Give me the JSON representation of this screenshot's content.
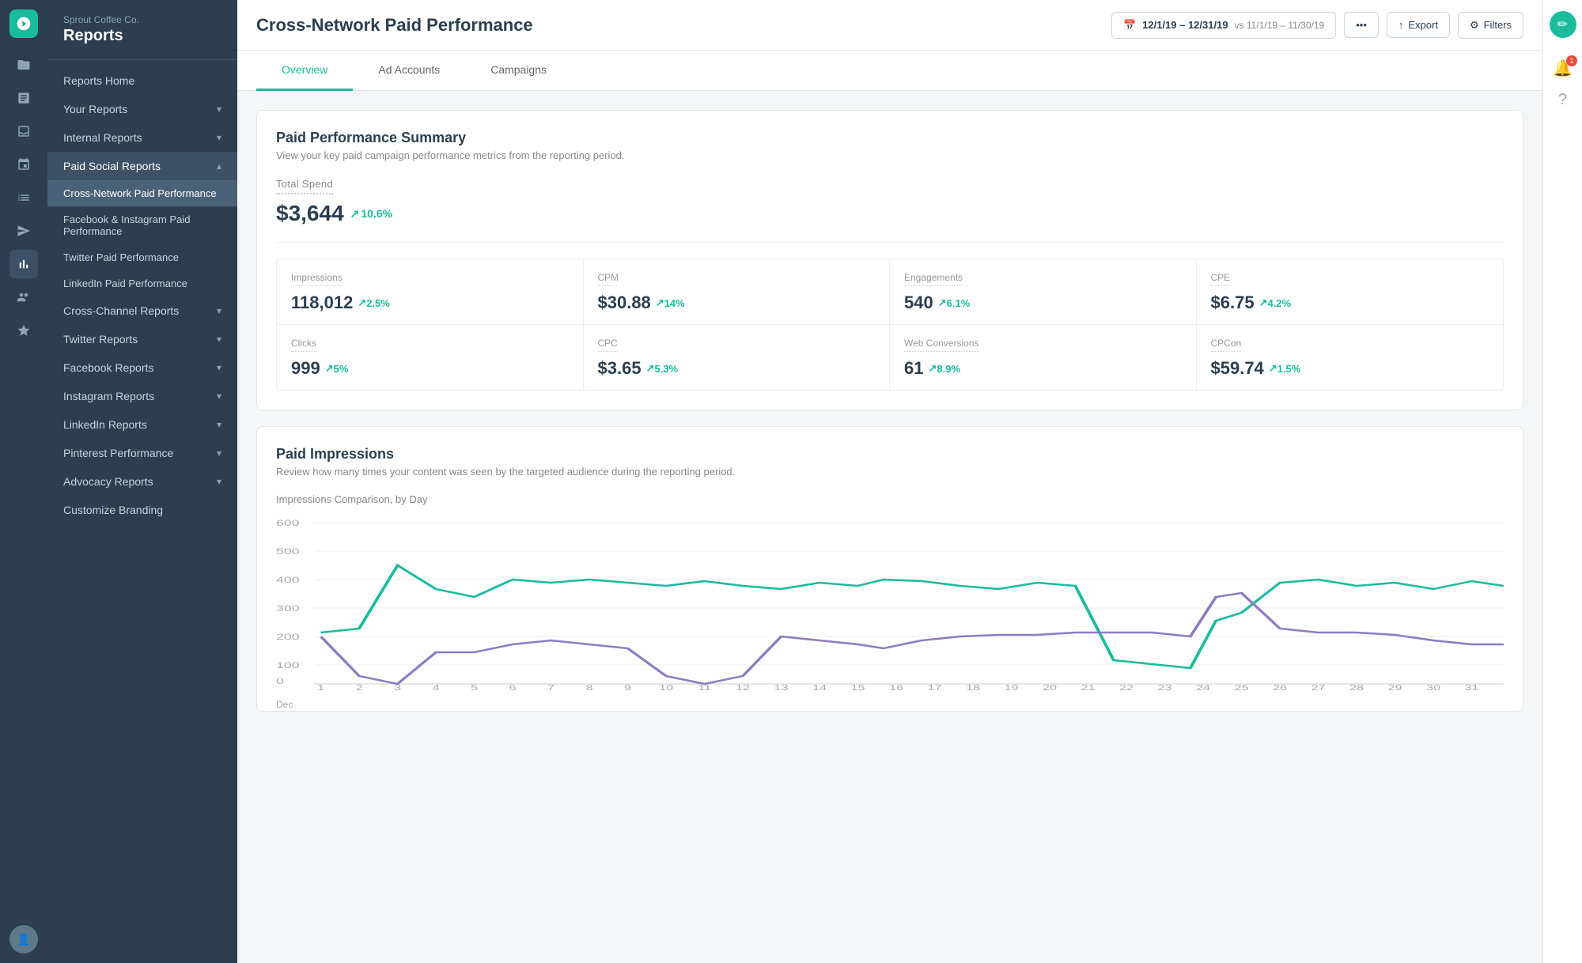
{
  "app": {
    "company": "Sprout Coffee Co.",
    "section": "Reports",
    "logo_char": "🌱"
  },
  "header": {
    "page_title": "Cross-Network Paid Performance",
    "date_range": "12/1/19 – 12/31/19",
    "date_compare": "vs 11/1/19 – 11/30/19",
    "export_label": "Export",
    "filters_label": "Filters"
  },
  "tabs": [
    {
      "id": "overview",
      "label": "Overview",
      "active": true
    },
    {
      "id": "ad-accounts",
      "label": "Ad Accounts",
      "active": false
    },
    {
      "id": "campaigns",
      "label": "Campaigns",
      "active": false
    }
  ],
  "sidebar": {
    "nav_items": [
      {
        "id": "reports-home",
        "label": "Reports Home",
        "expandable": false
      },
      {
        "id": "your-reports",
        "label": "Your Reports",
        "expandable": true
      },
      {
        "id": "internal-reports",
        "label": "Internal Reports",
        "expandable": true
      },
      {
        "id": "paid-social",
        "label": "Paid Social Reports",
        "expandable": true,
        "expanded": true
      },
      {
        "id": "cross-channel",
        "label": "Cross-Channel Reports",
        "expandable": true
      },
      {
        "id": "twitter-reports",
        "label": "Twitter Reports",
        "expandable": true
      },
      {
        "id": "facebook-reports",
        "label": "Facebook Reports",
        "expandable": true
      },
      {
        "id": "instagram-reports",
        "label": "Instagram Reports",
        "expandable": true
      },
      {
        "id": "linkedin-reports",
        "label": "LinkedIn Reports",
        "expandable": true
      },
      {
        "id": "pinterest-perf",
        "label": "Pinterest Performance",
        "expandable": true
      },
      {
        "id": "advocacy-reports",
        "label": "Advocacy Reports",
        "expandable": true
      },
      {
        "id": "customize-branding",
        "label": "Customize Branding",
        "expandable": false
      }
    ],
    "sub_items": [
      {
        "id": "cross-network",
        "label": "Cross-Network Paid Performance",
        "active": true
      },
      {
        "id": "fb-ig",
        "label": "Facebook & Instagram Paid Performance",
        "active": false
      },
      {
        "id": "twitter-paid",
        "label": "Twitter Paid Performance",
        "active": false
      },
      {
        "id": "linkedin-paid",
        "label": "LinkedIn Paid Performance",
        "active": false
      }
    ]
  },
  "summary": {
    "title": "Paid Performance Summary",
    "subtitle": "View your key paid campaign performance metrics from the reporting period.",
    "total_spend_label": "Total Spend",
    "total_spend_value": "$3,644",
    "total_spend_change": "10.6%",
    "metrics": [
      {
        "label": "Impressions",
        "value": "118,012",
        "change": "2.5%"
      },
      {
        "label": "CPM",
        "value": "$30.88",
        "change": "14%"
      },
      {
        "label": "Engagements",
        "value": "540",
        "change": "6.1%"
      },
      {
        "label": "CPE",
        "value": "$6.75",
        "change": "4.2%"
      },
      {
        "label": "Clicks",
        "value": "999",
        "change": "5%"
      },
      {
        "label": "CPC",
        "value": "$3.65",
        "change": "5.3%"
      },
      {
        "label": "Web Conversions",
        "value": "61",
        "change": "8.9%"
      },
      {
        "label": "CPCon",
        "value": "$59.74",
        "change": "1.5%"
      }
    ]
  },
  "impressions": {
    "title": "Paid Impressions",
    "subtitle": "Review how many times your content was seen by the targeted audience during the reporting period.",
    "chart_label": "Impressions Comparison, by Day",
    "y_labels": [
      "600",
      "500",
      "400",
      "300",
      "200",
      "100",
      "0"
    ],
    "x_labels": [
      "1",
      "2",
      "3",
      "4",
      "5",
      "6",
      "7",
      "8",
      "9",
      "10",
      "11",
      "12",
      "13",
      "14",
      "15",
      "16",
      "17",
      "18",
      "19",
      "20",
      "21",
      "22",
      "23",
      "24",
      "25",
      "26",
      "27",
      "28",
      "29",
      "30",
      "31"
    ],
    "x_month": "Dec",
    "series": {
      "current_color": "#1abc9c",
      "previous_color": "#8e7cc3"
    }
  },
  "colors": {
    "accent": "#1abc9c",
    "sidebar_bg": "#2c3e50",
    "active_item": "#4a6278",
    "text_primary": "#2c3e50",
    "text_muted": "#888"
  }
}
